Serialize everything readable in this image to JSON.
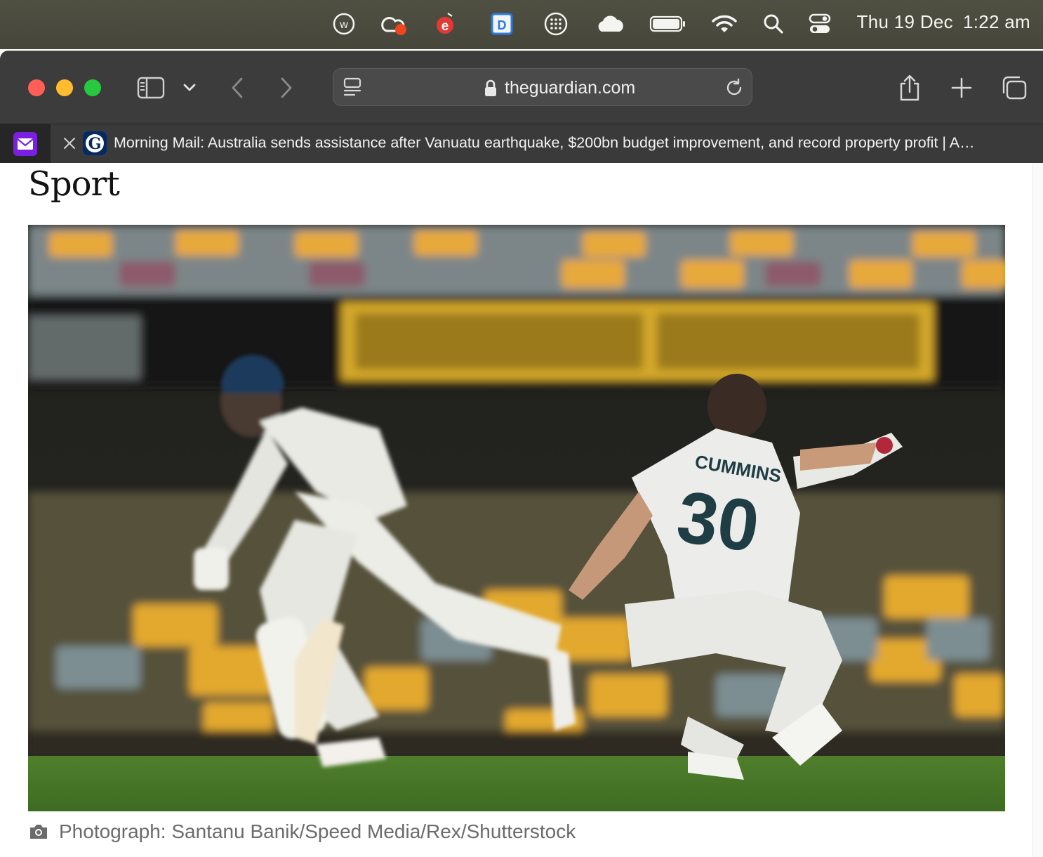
{
  "menubar": {
    "icons": [
      "w-circle-icon",
      "creative-cloud-icon",
      "e-badge-icon",
      "dash-icon",
      "dots-grid-icon",
      "cloud-icon",
      "battery-icon",
      "wifi-icon",
      "search-icon",
      "control-center-icon"
    ],
    "day": "Thu 19 Dec",
    "time": "1:22 am"
  },
  "browser": {
    "url": "theguardian.com",
    "active_tab_title": "Morning Mail: Australia sends assistance after Vanuatu earthquake, $200bn budget improvement, and record property profit | A…"
  },
  "page": {
    "section_title": "Sport",
    "photo_text": {
      "player_name": "CUMMINS",
      "player_number": "30"
    },
    "caption": "Photograph: Santanu Banik/Speed Media/Rex/Shutterstock"
  },
  "colors": {
    "menubar_bg": "#4a4a3f",
    "toolbar_bg": "#3c3c3c",
    "tabbar_bg": "#2e2e2e",
    "traffic_red": "#ff5f57",
    "traffic_yellow": "#febc2e",
    "traffic_green": "#28c840",
    "caption_text": "#6b6b6b"
  }
}
